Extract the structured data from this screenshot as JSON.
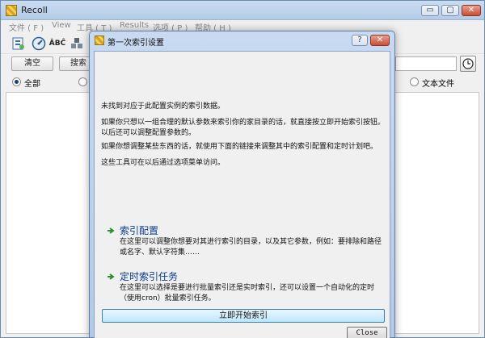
{
  "main_window": {
    "title": "Recoll",
    "controls": {
      "minimize": "▭",
      "maximize": "▢",
      "close": "✕"
    },
    "menu": [
      "文件 ( F )",
      "View",
      "工具 ( T )",
      "Results",
      "选项 ( P )",
      "帮助 ( H )"
    ],
    "search": {
      "clear_label": "清空",
      "search_label": "搜索"
    },
    "filters": {
      "all_label": "全部",
      "text_label": "文本文件",
      "selected": "all"
    }
  },
  "dialog": {
    "title": "第一次索引设置",
    "controls": {
      "help": "?",
      "close": "✕"
    },
    "paragraphs": [
      "未找到对应于此配置实例的索引数据。",
      "如果你只想以一组合理的默认参数来索引你的家目录的话，就直接按立即开始索引按钮。以后还可以调整配置参数的。",
      "如果你想调整某些东西的话，就使用下面的链接来调整其中的索引配置和定时计划吧。",
      "这些工具可在以后通过选项菜单访问。"
    ],
    "links": [
      {
        "title": "索引配置",
        "description": "在这里可以调整你想要对其进行索引的目录，以及其它参数，例如：要排除和路径或名字、默认字符集……"
      },
      {
        "title": "定时索引任务",
        "description": "在这里可以选择是要进行批量索引还是实时索引，还可以设置一个自动化的定时（使用cron）批量索引任务。"
      }
    ],
    "start_button_label": "立即开始索引",
    "close_button_label": "Close"
  },
  "colors": {
    "accent": "#0b3c8c",
    "arrow": "#2f8f2f",
    "title_bar": "#b4cbe6"
  },
  "icons": [
    "preview-icon",
    "update-index-icon",
    "spell-icon",
    "query-icon",
    "clock-icon",
    "right-arrow-icon"
  ]
}
